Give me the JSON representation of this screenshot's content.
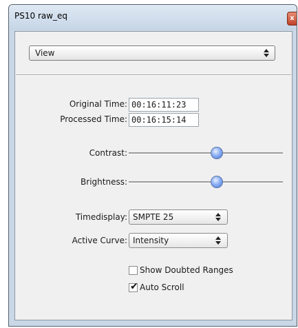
{
  "window": {
    "title": "PS10 raw_eq",
    "close_glyph": "x"
  },
  "view": {
    "selected": "View"
  },
  "times": {
    "original_label": "Original Time:",
    "original_value": "00:16:11:23",
    "processed_label": "Processed Time:",
    "processed_value": "00:16:15:14"
  },
  "sliders": {
    "contrast_label": "Contrast:",
    "contrast_value": 0.58,
    "brightness_label": "Brightness:",
    "brightness_value": 0.58
  },
  "options": {
    "timedisplay_label": "Timedisplay:",
    "timedisplay_value": "SMPTE 25",
    "active_curve_label": "Active Curve:",
    "active_curve_value": "Intensity"
  },
  "checks": {
    "show_doubted_label": "Show Doubted Ranges",
    "show_doubted_checked": false,
    "auto_scroll_label": "Auto Scroll",
    "auto_scroll_checked": true
  },
  "colors": {
    "window_frame": "#c9d7e7",
    "client_bg": "#f0f0f0",
    "close_button": "#c0432a",
    "slider_thumb": "#6a8ee8"
  },
  "icons": {
    "close": "close-icon",
    "select_arrows": "updown-arrows-icon",
    "checkmark": "checkmark-icon"
  }
}
